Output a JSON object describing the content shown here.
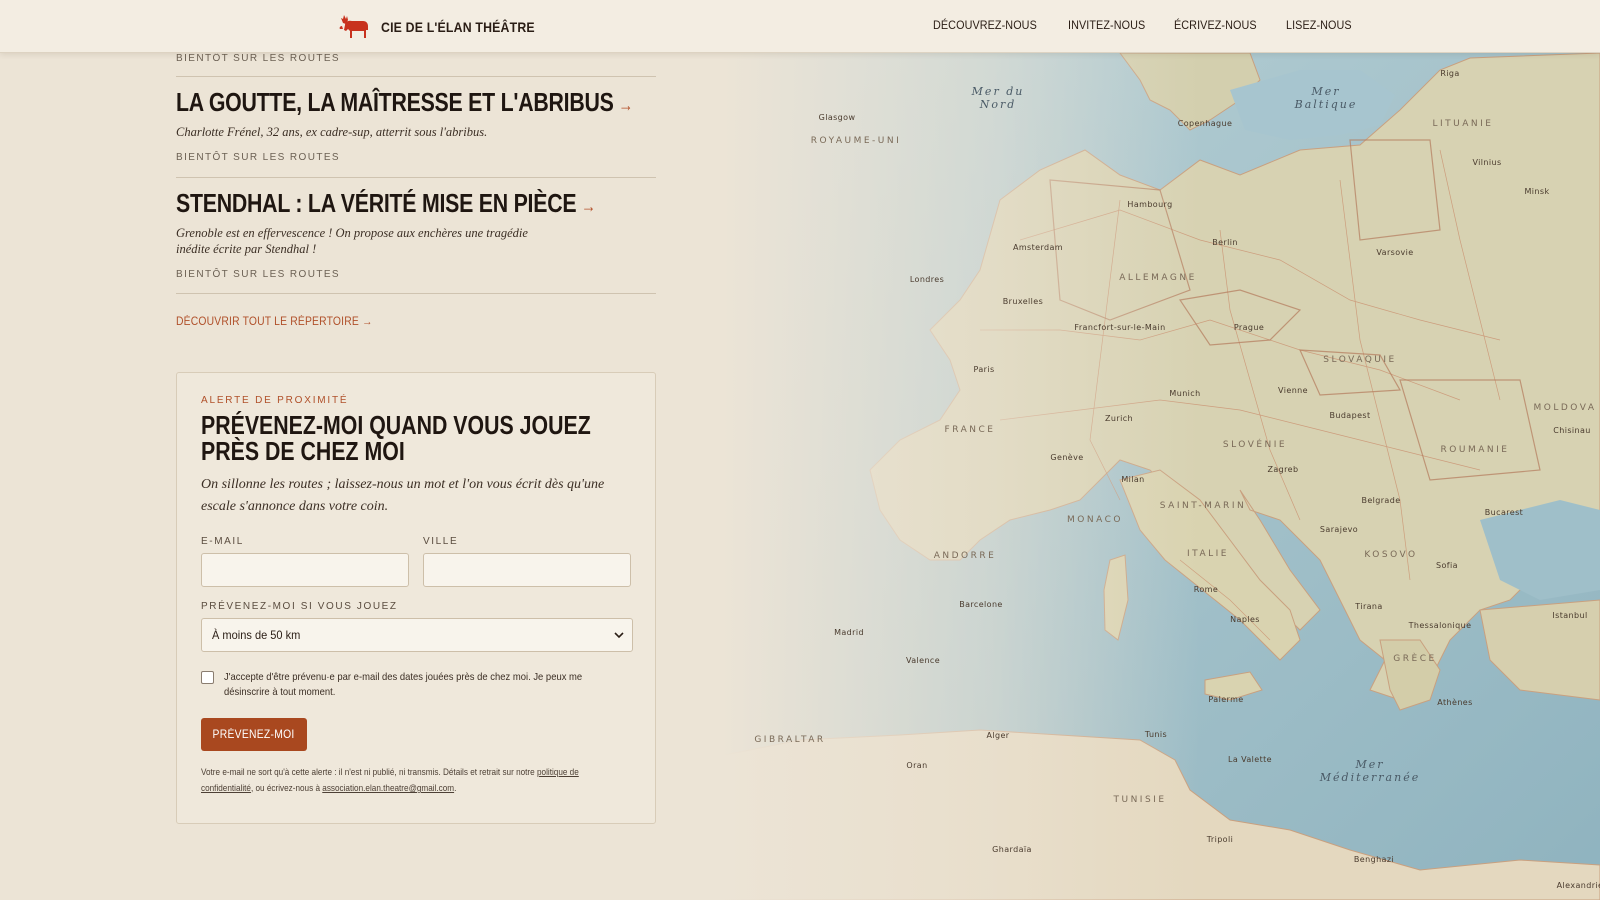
{
  "header": {
    "brand_name": "CIE DE L'ÉLAN THÉÂTRE",
    "brand_icon": "moose-icon",
    "nav": [
      {
        "label": "DÉCOUVREZ-NOUS"
      },
      {
        "label": "INVITEZ-NOUS"
      },
      {
        "label": "ÉCRIVEZ-NOUS"
      },
      {
        "label": "LISEZ-NOUS"
      }
    ]
  },
  "repertoire": {
    "top_status": "BIENTÔT SUR LES ROUTES",
    "plays": [
      {
        "title": "LA GOUTTE, LA MAÎTRESSE ET L'ABRIBUS",
        "arrow": "→",
        "description": "Charlotte Frénel, 32 ans, ex cadre-sup, atterrit sous l'abribus.",
        "status": "BIENTÔT SUR LES ROUTES"
      },
      {
        "title": "STENDHAL : LA VÉRITÉ MISE EN PIÈCE",
        "arrow": "→",
        "description": "Grenoble est en effervescence ! On propose aux enchères une tragédie inédite écrite par Stendhal !",
        "status": "BIENTÔT SUR LES ROUTES"
      }
    ],
    "all_link": "DÉCOUVRIR TOUT LE RÉPERTOIRE →"
  },
  "alert_form": {
    "eyebrow": "ALERTE DE PROXIMITÉ",
    "title": "PRÉVENEZ-MOI QUAND VOUS JOUEZ PRÈS DE CHEZ MOI",
    "lead": "On sillonne les routes ; laissez-nous un mot et l'on vous écrit dès qu'une escale s'annonce dans votre coin.",
    "email_label": "E-MAIL",
    "email_value": "",
    "city_label": "VILLE",
    "city_value": "",
    "distance_label": "PRÉVENEZ-MOI SI VOUS JOUEZ",
    "distance_value": "À moins de 50 km",
    "consent_checked": false,
    "consent_text": "J'accepte d'être prévenu·e par e-mail des dates jouées près de chez moi. Je peux me désinscrire à tout moment.",
    "submit_label": "PRÉVENEZ-MOI",
    "legal_prefix": "Votre e-mail ne sort qu'à cette alerte : il n'est ni publié, ni transmis. Détails et retrait sur notre ",
    "legal_link": "politique de confidentialité",
    "legal_middle": ", ou écrivez-nous à ",
    "legal_email": "association.elan.theatre@gmail.com",
    "legal_suffix": "."
  },
  "map": {
    "seas": [
      "Mer du Nord",
      "Mer Baltique",
      "Mer Méditerranée"
    ],
    "countries": [
      "LITUANIE",
      "ALLEMAGNE",
      "FRANCE",
      "SLOVAQUIE",
      "SLOVÉNIE",
      "ROUMANIE",
      "MOLDOVA",
      "MONACO",
      "SAINT-MARIN",
      "ITALIE",
      "KOSOVO",
      "GRÈCE",
      "ANDORRE",
      "TUNISIE",
      "ROYAUME-UNI",
      "GIBRALTAR"
    ],
    "cities": [
      "Riga",
      "Copenhague",
      "Vilnius",
      "Minsk",
      "Hambourg",
      "Berlin",
      "Amsterdam",
      "Varsovie",
      "Londres",
      "Bruxelles",
      "Francfort-sur-le-Main",
      "Prague",
      "Paris",
      "Munich",
      "Vienne",
      "Budapest",
      "Zurich",
      "Chisinau",
      "Genève",
      "Zagreb",
      "Milan",
      "Belgrade",
      "Bucarest",
      "Sarajevo",
      "Sofia",
      "Rome",
      "Barcelone",
      "Tirana",
      "Istanbul",
      "Naples",
      "Thessalonique",
      "Madrid",
      "Valence",
      "Palerme",
      "Athènes",
      "Alger",
      "Tunis",
      "La Valette",
      "Oran",
      "Tripoli",
      "Benghazi",
      "Ghardaïa",
      "Alexandrie",
      "Glasgow"
    ]
  }
}
